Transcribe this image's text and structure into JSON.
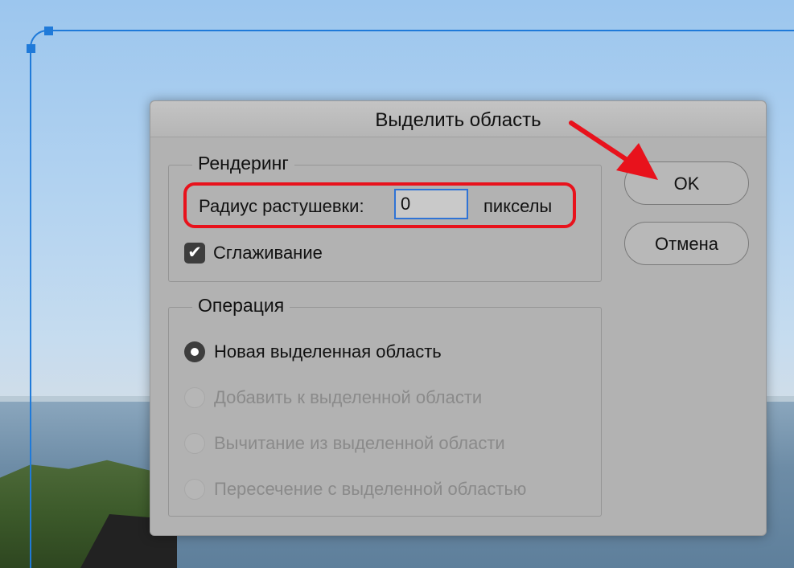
{
  "dialog": {
    "title": "Выделить область",
    "rendering": {
      "legend": "Рендеринг",
      "feather_label": "Радиус растушевки:",
      "feather_value": "0",
      "feather_unit": "пикселы",
      "antialias_label": "Сглаживание",
      "antialias_checked": true
    },
    "operation": {
      "legend": "Операция",
      "options": [
        {
          "label": "Новая выделенная область",
          "selected": true,
          "enabled": true
        },
        {
          "label": "Добавить к выделенной области",
          "selected": false,
          "enabled": false
        },
        {
          "label": "Вычитание из выделенной области",
          "selected": false,
          "enabled": false
        },
        {
          "label": "Пересечение с выделенной областью",
          "selected": false,
          "enabled": false
        }
      ]
    },
    "buttons": {
      "ok": "OK",
      "cancel": "Отмена"
    }
  },
  "colors": {
    "annotation": "#e8121c",
    "selection": "#1f7ad9",
    "input_focus": "#2f73d6"
  },
  "icons": {
    "checkbox": "checkmark-icon",
    "arrow": "red-arrow-annotation"
  }
}
